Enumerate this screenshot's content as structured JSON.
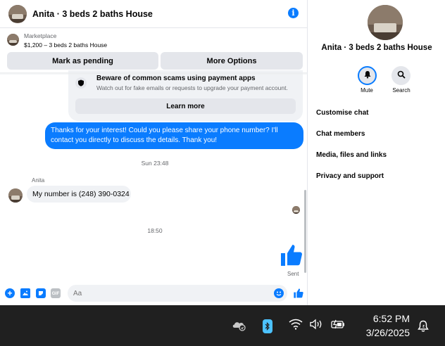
{
  "chat": {
    "header_title": "Anita · 3 beds 2 baths House",
    "listing_source": "Marketplace",
    "listing_detail": "$1,200 – 3 beds 2 baths House",
    "mark_pending_label": "Mark as pending",
    "more_options_label": "More Options"
  },
  "scam_card": {
    "title": "Beware of common scams using payment apps",
    "text": "Watch out for fake emails or requests to upgrade your payment account.",
    "learn_more_label": "Learn more"
  },
  "messages": {
    "outgoing_1": "Thanks for your interest! Could you please share your phone number? I'll contact you directly to discuss the details. Thank you!",
    "timestamp_1": "Sun 23:48",
    "sender_name": "Anita",
    "incoming_1": "My number is (248) 390-0324",
    "timestamp_2": "18:50",
    "sent_status": "Sent"
  },
  "composer": {
    "placeholder": "Aa",
    "gif_label": "GIF"
  },
  "info_panel": {
    "title": "Anita · 3 beds 2 baths House",
    "mute_label": "Mute",
    "search_label": "Search",
    "items": [
      {
        "label": "Customise chat"
      },
      {
        "label": "Chat members"
      },
      {
        "label": "Media, files and links"
      },
      {
        "label": "Privacy and support"
      }
    ]
  },
  "taskbar": {
    "time": "6:52 PM",
    "date": "3/26/2025",
    "icons": [
      "onedrive-icon",
      "bluetooth-icon",
      "wifi-icon",
      "volume-icon",
      "battery-icon",
      "notification-icon"
    ]
  },
  "colors": {
    "accent": "#0a7cff",
    "bubble_in": "#f0f2f5",
    "taskbar_bg": "#202020"
  }
}
